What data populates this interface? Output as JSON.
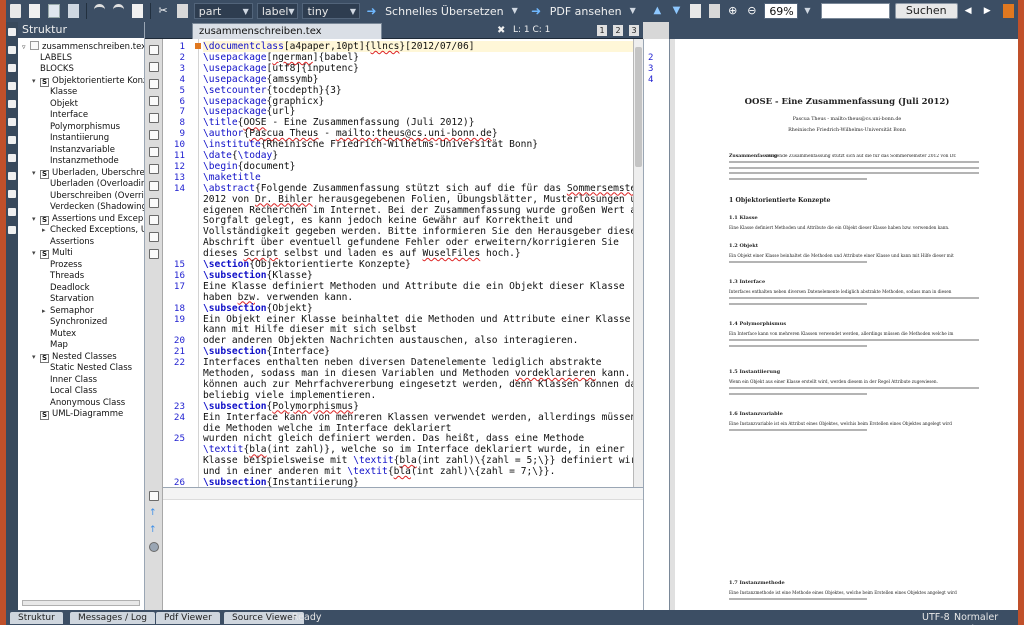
{
  "toolbar": {
    "combo_part": "part",
    "combo_label": "label",
    "combo_size": "tiny",
    "translate_label": "Schnelles Übersetzen",
    "pdf_label": "PDF ansehen",
    "zoom": "69%",
    "search_button": "Suchen"
  },
  "structure": {
    "title": "Struktur",
    "items": [
      {
        "label": "zusammenschreiben.tex",
        "level": 0,
        "twisty": "▿",
        "sec": ""
      },
      {
        "label": "LABELS",
        "level": 1,
        "twisty": "",
        "sec": ""
      },
      {
        "label": "BLOCKS",
        "level": 1,
        "twisty": "",
        "sec": ""
      },
      {
        "label": "Objektorientierte Konz",
        "level": 1,
        "twisty": "▾",
        "sec": "S"
      },
      {
        "label": "Klasse",
        "level": 2,
        "twisty": "",
        "sec": ""
      },
      {
        "label": "Objekt",
        "level": 2,
        "twisty": "",
        "sec": ""
      },
      {
        "label": "Interface",
        "level": 2,
        "twisty": "",
        "sec": ""
      },
      {
        "label": "Polymorphismus",
        "level": 2,
        "twisty": "",
        "sec": ""
      },
      {
        "label": "Instantiierung",
        "level": 2,
        "twisty": "",
        "sec": ""
      },
      {
        "label": "Instanzvariable",
        "level": 2,
        "twisty": "",
        "sec": ""
      },
      {
        "label": "Instanzmethode",
        "level": 2,
        "twisty": "",
        "sec": ""
      },
      {
        "label": "Überladen, Überschre",
        "level": 1,
        "twisty": "▾",
        "sec": "S"
      },
      {
        "label": "Überladen (Overloadin",
        "level": 2,
        "twisty": "",
        "sec": ""
      },
      {
        "label": "Überschreiben (Overri",
        "level": 2,
        "twisty": "",
        "sec": ""
      },
      {
        "label": "Verdecken (Shadowing",
        "level": 2,
        "twisty": "",
        "sec": ""
      },
      {
        "label": "Assertions und Excep",
        "level": 1,
        "twisty": "▾",
        "sec": "S"
      },
      {
        "label": "Checked Exceptions, U",
        "level": 2,
        "twisty": "▸",
        "sec": ""
      },
      {
        "label": "Assertions",
        "level": 2,
        "twisty": "",
        "sec": ""
      },
      {
        "label": "Multi",
        "level": 1,
        "twisty": "▾",
        "sec": "S"
      },
      {
        "label": "Prozess",
        "level": 2,
        "twisty": "",
        "sec": ""
      },
      {
        "label": "Threads",
        "level": 2,
        "twisty": "",
        "sec": ""
      },
      {
        "label": "Deadlock",
        "level": 2,
        "twisty": "",
        "sec": ""
      },
      {
        "label": "Starvation",
        "level": 2,
        "twisty": "",
        "sec": ""
      },
      {
        "label": "Semaphor",
        "level": 2,
        "twisty": "▸",
        "sec": ""
      },
      {
        "label": "Synchronized",
        "level": 2,
        "twisty": "",
        "sec": ""
      },
      {
        "label": "Mutex",
        "level": 2,
        "twisty": "",
        "sec": ""
      },
      {
        "label": "Map",
        "level": 2,
        "twisty": "",
        "sec": ""
      },
      {
        "label": "Nested Classes",
        "level": 1,
        "twisty": "▾",
        "sec": "S"
      },
      {
        "label": "Static Nested Class",
        "level": 2,
        "twisty": "",
        "sec": ""
      },
      {
        "label": "Inner Class",
        "level": 2,
        "twisty": "",
        "sec": ""
      },
      {
        "label": "Local Class",
        "level": 2,
        "twisty": "",
        "sec": ""
      },
      {
        "label": "Anonymous Class",
        "level": 2,
        "twisty": "",
        "sec": ""
      },
      {
        "label": "UML-Diagramme",
        "level": 1,
        "twisty": "",
        "sec": "S"
      }
    ]
  },
  "editor": {
    "tab_title": "zusammenschreiben.tex",
    "tab_close": "✖",
    "cursor_position": "L: 1 C: 1",
    "view_buttons": [
      "1",
      "2",
      "3"
    ],
    "line_numbers": [
      {
        "n": "1",
        "row": 0
      },
      {
        "n": "2",
        "row": 1
      },
      {
        "n": "3",
        "row": 2
      },
      {
        "n": "4",
        "row": 3
      },
      {
        "n": "5",
        "row": 4
      },
      {
        "n": "6",
        "row": 5
      },
      {
        "n": "7",
        "row": 6
      },
      {
        "n": "8",
        "row": 7
      },
      {
        "n": "9",
        "row": 8
      },
      {
        "n": "10",
        "row": 9
      },
      {
        "n": "11",
        "row": 10
      },
      {
        "n": "12",
        "row": 11
      },
      {
        "n": "13",
        "row": 12
      },
      {
        "n": "14",
        "row": 13
      },
      {
        "n": "15",
        "row": 20
      },
      {
        "n": "16",
        "row": 21
      },
      {
        "n": "17",
        "row": 22
      },
      {
        "n": "18",
        "row": 24
      },
      {
        "n": "19",
        "row": 25
      },
      {
        "n": "20",
        "row": 27
      },
      {
        "n": "21",
        "row": 28
      },
      {
        "n": "22",
        "row": 29
      },
      {
        "n": "23",
        "row": 33
      },
      {
        "n": "24",
        "row": 34
      },
      {
        "n": "25",
        "row": 36
      },
      {
        "n": "26",
        "row": 40
      }
    ],
    "lines": [
      [
        {
          "t": "\\documentclass",
          "c": "cmd"
        },
        {
          "t": "[a4paper,10pt]{"
        },
        {
          "t": "llncs",
          "c": "sp"
        },
        {
          "t": "}[2012/07/06]"
        }
      ],
      [
        {
          "t": "\\usepackage",
          "c": "cmd"
        },
        {
          "t": "["
        },
        {
          "t": "ngerman",
          "c": "sp"
        },
        {
          "t": "]{babel}"
        }
      ],
      [
        {
          "t": "\\usepackage",
          "c": "cmd"
        },
        {
          "t": "[utf8]{inputenc}"
        }
      ],
      [
        {
          "t": "\\usepackage",
          "c": "cmd"
        },
        {
          "t": "{amssymb}"
        }
      ],
      [
        {
          "t": "\\setcounter",
          "c": "cmd"
        },
        {
          "t": "{tocdepth}{3}"
        }
      ],
      [
        {
          "t": "\\usepackage",
          "c": "cmd"
        },
        {
          "t": "{graphicx}"
        }
      ],
      [
        {
          "t": "\\usepackage",
          "c": "cmd"
        },
        {
          "t": "{url}"
        }
      ],
      [
        {
          "t": "\\title",
          "c": "cmd"
        },
        {
          "t": "{"
        },
        {
          "t": "OOSE",
          "c": "sp"
        },
        {
          "t": " - Eine Zusammenfassung (Juli 2012)}"
        }
      ],
      [
        {
          "t": "\\author",
          "c": "cmd"
        },
        {
          "t": "{"
        },
        {
          "t": "Pascua Theus",
          "c": "sp"
        },
        {
          "t": " - "
        },
        {
          "t": "mailto:theus@cs.uni-bonn.de",
          "c": "sp"
        },
        {
          "t": "}"
        }
      ],
      [
        {
          "t": "\\institute",
          "c": "cmd"
        },
        {
          "t": "{Rheinische Friedrich-Wilhelms-Universität Bonn}"
        }
      ],
      [
        {
          "t": "\\date",
          "c": "cmd"
        },
        {
          "t": "{"
        },
        {
          "t": "\\today",
          "c": "cmd"
        },
        {
          "t": "}"
        }
      ],
      [
        {
          "t": "\\begin",
          "c": "cmd"
        },
        {
          "t": "{document}"
        }
      ],
      [
        {
          "t": "\\maketitle",
          "c": "cmd"
        }
      ],
      [
        {
          "t": "\\abstract",
          "c": "cmd"
        },
        {
          "t": "{Folgende Zusammenfassung stützt sich auf die für das "
        },
        {
          "t": "Sommersemster",
          "c": "sp"
        }
      ],
      [
        {
          "t": "2012 von "
        },
        {
          "t": "Dr. Bihler",
          "c": "sp"
        },
        {
          "t": " herausgegebenen Folien, Übungsblätter, Musterlösungen und"
        }
      ],
      [
        {
          "t": "eigenen Recherchen im Internet. Bei der Zusammenfassung wurde großen Wert auf"
        }
      ],
      [
        {
          "t": "Sorgfalt gelegt, es kann jedoch keine Gewähr auf Korrektheit und"
        }
      ],
      [
        {
          "t": "Vollständigkeit gegeben werden. Bitte informieren Sie den Herausgeber dieser"
        }
      ],
      [
        {
          "t": "Abschrift über eventuell gefundene Fehler oder erweitern/korrigieren Sie"
        }
      ],
      [
        {
          "t": "dieses "
        },
        {
          "t": "Script",
          "c": "sp"
        },
        {
          "t": " selbst und laden es auf "
        },
        {
          "t": "WuselFiles",
          "c": "sp"
        },
        {
          "t": " hoch.}"
        }
      ],
      [
        {
          "t": "\\section",
          "c": "kw"
        },
        {
          "t": "{Objektorientierte Konzepte}"
        }
      ],
      [
        {
          "t": "\\subsection",
          "c": "kw"
        },
        {
          "t": "{Klasse}"
        }
      ],
      [
        {
          "t": "Eine Klasse definiert Methoden und Attribute die ein Objekt dieser Klasse"
        }
      ],
      [
        {
          "t": "haben "
        },
        {
          "t": "bzw",
          "c": "sp"
        },
        {
          "t": ". verwenden kann."
        }
      ],
      [
        {
          "t": "\\subsection",
          "c": "kw"
        },
        {
          "t": "{Objekt}"
        }
      ],
      [
        {
          "t": "Ein Objekt einer Klasse beinhaltet die Methoden und Attribute einer Klasse und"
        }
      ],
      [
        {
          "t": "kann mit Hilfe dieser mit sich selbst"
        }
      ],
      [
        {
          "t": "oder anderen Objekten Nachrichten austauschen, also interagieren."
        }
      ],
      [
        {
          "t": "\\subsection",
          "c": "kw"
        },
        {
          "t": "{Interface}"
        }
      ],
      [
        {
          "t": "Interfaces enthalten neben diversen Datenelemente lediglich abstrakte"
        }
      ],
      [
        {
          "t": "Methoden, sodass man in diesen Variablen und Methoden "
        },
        {
          "t": "vordeklarieren",
          "c": "sp"
        },
        {
          "t": " kann. Sie"
        }
      ],
      [
        {
          "t": "können auch zur Mehrfachvererbung eingesetzt werden, denn Klassen können davon"
        }
      ],
      [
        {
          "t": "beliebig viele implementieren."
        }
      ],
      [
        {
          "t": "\\subsection",
          "c": "kw"
        },
        {
          "t": "{"
        },
        {
          "t": "Polymorphismus",
          "c": "sp"
        },
        {
          "t": "}"
        }
      ],
      [
        {
          "t": "Ein Interface kann von mehreren Klassen verwendet werden, allerdings müssen"
        }
      ],
      [
        {
          "t": "die Methoden welche im Interface deklariert"
        }
      ],
      [
        {
          "t": "wurden nicht gleich definiert werden. Das heißt, dass eine Methode"
        }
      ],
      [
        {
          "t": "\\textit",
          "c": "cmd"
        },
        {
          "t": "{"
        },
        {
          "t": "bla",
          "c": "sp"
        },
        {
          "t": "(int zahl)}, welche so im Interface deklariert wurde, in einer"
        }
      ],
      [
        {
          "t": "Klasse beispielsweise mit "
        },
        {
          "t": "\\textit",
          "c": "cmd"
        },
        {
          "t": "{"
        },
        {
          "t": "bla",
          "c": "sp"
        },
        {
          "t": "(int zahl)\\{zahl = 5;\\}} definiert wird"
        }
      ],
      [
        {
          "t": "und in einer anderen mit "
        },
        {
          "t": "\\textit",
          "c": "cmd"
        },
        {
          "t": "{"
        },
        {
          "t": "bla",
          "c": "sp"
        },
        {
          "t": "(int zahl)\\{zahl = 7;\\}}."
        }
      ],
      [
        {
          "t": "\\subsection",
          "c": "kw"
        },
        {
          "t": "{Instantiierung}"
        }
      ]
    ]
  },
  "pdf_line_numbers": [
    "2",
    "3",
    "4"
  ],
  "pdf": {
    "title": "OOSE - Eine Zusammenfassung (Juli 2012)",
    "author": "Pascua Theus - mailto:theus@cs.uni-bonn.de",
    "institute": "Rheinische Friedrich-Wilhelms-Universität Bonn",
    "abstract_label": "Zusammenfassung",
    "abstract_text": "Folgende Zusammenfassung stützt sich auf die für das Sommersemster 2012 von Dr.",
    "section": "1   Objektorientierte Konzepte",
    "subsections": [
      {
        "title": "1.1   Klasse",
        "text": "Eine Klasse definiert Methoden und Attribute die ein Objekt dieser Klasse haben bzw. verwenden kann."
      },
      {
        "title": "1.2   Objekt",
        "text": "Ein Objekt einer Klasse beinhaltet die Methoden und Attribute einer Klasse und kann mit Hilfe dieser mit"
      },
      {
        "title": "1.3   Interface",
        "text": "Interfaces enthalten neben diversen Datenelemente lediglich abstrakte Methoden, sodass man in diesen"
      },
      {
        "title": "1.4   Polymorphismus",
        "text": "Ein Interface kann von mehreren Klassen verwendet werden, allerdings müssen die Methoden welche im"
      },
      {
        "title": "1.5   Instantiierung",
        "text": "Wenn ein Objekt aus einer Klasse erstellt wird, werden diesem in der Regel Attribute zugewiesen."
      },
      {
        "title": "1.6   Instanzvariable",
        "text": "Eine Instanzvariable ist ein Attribut eines Objektes, welchis beim Erstellen eines Objektes angelegt wird"
      },
      {
        "title": "1.7   Instanzmethode",
        "text": "Eine Instanzmethode ist eine Methode eines Objektes, welche beim Erstellen eines Objektes angelegt wird"
      }
    ]
  },
  "statusbar": {
    "tabs": [
      "Struktur",
      "Messages / Log",
      "Pdf Viewer",
      "Source Viewer"
    ],
    "status": "Ready",
    "encoding": "UTF-8",
    "mode": "Normaler Modus"
  }
}
